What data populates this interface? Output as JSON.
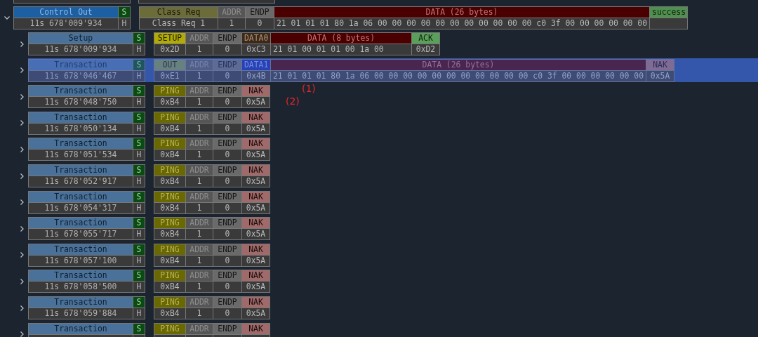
{
  "transfer": {
    "name": "Control Out",
    "time": "11s 678'009'934",
    "s_flag": "S",
    "h_flag": "H",
    "expanded": true,
    "fields": [
      {
        "kind": "request",
        "header": "Class Req",
        "value": "Class Req 1"
      },
      {
        "kind": "addr",
        "header": "ADDR",
        "value": "1"
      },
      {
        "kind": "endp",
        "header": "ENDP",
        "value": "0"
      },
      {
        "kind": "data",
        "header": "DATA (26 bytes)",
        "value": "21 01 01 01 80 1a 06 00 00 00 00 00 00 00 00 00 00 00 c0 3f 00 00 00 00 00 00"
      },
      {
        "kind": "status",
        "header": "success"
      }
    ],
    "children": [
      {
        "name": "Setup",
        "time": "11s 678'009'934",
        "s_flag": "S",
        "h_flag": "H",
        "expanded": false,
        "selected": false,
        "fields": [
          {
            "kind": "setup",
            "header": "SETUP",
            "value": "0x2D"
          },
          {
            "kind": "addr",
            "header": "ADDR",
            "value": "1"
          },
          {
            "kind": "endp",
            "header": "ENDP",
            "value": "0"
          },
          {
            "kind": "data0",
            "header": "DATA0",
            "value": "0xC3"
          },
          {
            "kind": "data",
            "header": "DATA (8 bytes)",
            "value": "21 01 00 01 01 00 1a 00"
          },
          {
            "kind": "ack",
            "header": "ACK",
            "value": "0xD2"
          }
        ]
      },
      {
        "name": "Transaction",
        "time": "11s 678'046'467",
        "s_flag": "S",
        "h_flag": "H",
        "expanded": false,
        "selected": true,
        "fields": [
          {
            "kind": "out",
            "header": "OUT",
            "value": "0xE1"
          },
          {
            "kind": "addr",
            "header": "ADDR",
            "value": "1"
          },
          {
            "kind": "endp",
            "header": "ENDP",
            "value": "0"
          },
          {
            "kind": "data1",
            "header": "DATA1",
            "value": "0x4B"
          },
          {
            "kind": "data",
            "header": "DATA (26 bytes)",
            "value": "21 01 01 01 80 1a 06 00 00 00 00 00 00 00 00 00 00 00 c0 3f 00 00 00 00 00 00"
          },
          {
            "kind": "nak",
            "header": "NAK",
            "value": "0x5A"
          }
        ]
      },
      {
        "name": "Transaction",
        "time": "11s 678'048'750",
        "s_flag": "S",
        "h_flag": "H",
        "expanded": false,
        "selected": false,
        "fields": [
          {
            "kind": "ping",
            "header": "PING",
            "value": "0xB4"
          },
          {
            "kind": "addr",
            "header": "ADDR",
            "value": "1"
          },
          {
            "kind": "endp",
            "header": "ENDP",
            "value": "0"
          },
          {
            "kind": "nak",
            "header": "NAK",
            "value": "0x5A"
          }
        ]
      },
      {
        "name": "Transaction",
        "time": "11s 678'050'134",
        "s_flag": "S",
        "h_flag": "H",
        "expanded": false,
        "selected": false,
        "fields": [
          {
            "kind": "ping",
            "header": "PING",
            "value": "0xB4"
          },
          {
            "kind": "addr",
            "header": "ADDR",
            "value": "1"
          },
          {
            "kind": "endp",
            "header": "ENDP",
            "value": "0"
          },
          {
            "kind": "nak",
            "header": "NAK",
            "value": "0x5A"
          }
        ]
      },
      {
        "name": "Transaction",
        "time": "11s 678'051'534",
        "s_flag": "S",
        "h_flag": "H",
        "expanded": false,
        "selected": false,
        "fields": [
          {
            "kind": "ping",
            "header": "PING",
            "value": "0xB4"
          },
          {
            "kind": "addr",
            "header": "ADDR",
            "value": "1"
          },
          {
            "kind": "endp",
            "header": "ENDP",
            "value": "0"
          },
          {
            "kind": "nak",
            "header": "NAK",
            "value": "0x5A"
          }
        ]
      },
      {
        "name": "Transaction",
        "time": "11s 678'052'917",
        "s_flag": "S",
        "h_flag": "H",
        "expanded": false,
        "selected": false,
        "fields": [
          {
            "kind": "ping",
            "header": "PING",
            "value": "0xB4"
          },
          {
            "kind": "addr",
            "header": "ADDR",
            "value": "1"
          },
          {
            "kind": "endp",
            "header": "ENDP",
            "value": "0"
          },
          {
            "kind": "nak",
            "header": "NAK",
            "value": "0x5A"
          }
        ]
      },
      {
        "name": "Transaction",
        "time": "11s 678'054'317",
        "s_flag": "S",
        "h_flag": "H",
        "expanded": false,
        "selected": false,
        "fields": [
          {
            "kind": "ping",
            "header": "PING",
            "value": "0xB4"
          },
          {
            "kind": "addr",
            "header": "ADDR",
            "value": "1"
          },
          {
            "kind": "endp",
            "header": "ENDP",
            "value": "0"
          },
          {
            "kind": "nak",
            "header": "NAK",
            "value": "0x5A"
          }
        ]
      },
      {
        "name": "Transaction",
        "time": "11s 678'055'717",
        "s_flag": "S",
        "h_flag": "H",
        "expanded": false,
        "selected": false,
        "fields": [
          {
            "kind": "ping",
            "header": "PING",
            "value": "0xB4"
          },
          {
            "kind": "addr",
            "header": "ADDR",
            "value": "1"
          },
          {
            "kind": "endp",
            "header": "ENDP",
            "value": "0"
          },
          {
            "kind": "nak",
            "header": "NAK",
            "value": "0x5A"
          }
        ]
      },
      {
        "name": "Transaction",
        "time": "11s 678'057'100",
        "s_flag": "S",
        "h_flag": "H",
        "expanded": false,
        "selected": false,
        "fields": [
          {
            "kind": "ping",
            "header": "PING",
            "value": "0xB4"
          },
          {
            "kind": "addr",
            "header": "ADDR",
            "value": "1"
          },
          {
            "kind": "endp",
            "header": "ENDP",
            "value": "0"
          },
          {
            "kind": "nak",
            "header": "NAK",
            "value": "0x5A"
          }
        ]
      },
      {
        "name": "Transaction",
        "time": "11s 678'058'500",
        "s_flag": "S",
        "h_flag": "H",
        "expanded": false,
        "selected": false,
        "fields": [
          {
            "kind": "ping",
            "header": "PING",
            "value": "0xB4"
          },
          {
            "kind": "addr",
            "header": "ADDR",
            "value": "1"
          },
          {
            "kind": "endp",
            "header": "ENDP",
            "value": "0"
          },
          {
            "kind": "nak",
            "header": "NAK",
            "value": "0x5A"
          }
        ]
      },
      {
        "name": "Transaction",
        "time": "11s 678'059'884",
        "s_flag": "S",
        "h_flag": "H",
        "expanded": false,
        "selected": false,
        "fields": [
          {
            "kind": "ping",
            "header": "PING",
            "value": "0xB4"
          },
          {
            "kind": "addr",
            "header": "ADDR",
            "value": "1"
          },
          {
            "kind": "endp",
            "header": "ENDP",
            "value": "0"
          },
          {
            "kind": "nak",
            "header": "NAK",
            "value": "0x5A"
          }
        ]
      },
      {
        "name": "Transaction",
        "s_flag": "S",
        "expanded": false,
        "selected": false,
        "fields": [
          {
            "kind": "ping",
            "header": "PING"
          },
          {
            "kind": "addr",
            "header": "ADDR"
          },
          {
            "kind": "endp",
            "header": "ENDP"
          },
          {
            "kind": "nak",
            "header": "NAK"
          }
        ]
      }
    ]
  },
  "annotations": [
    {
      "text": "(1)"
    },
    {
      "text": "(2)"
    }
  ]
}
